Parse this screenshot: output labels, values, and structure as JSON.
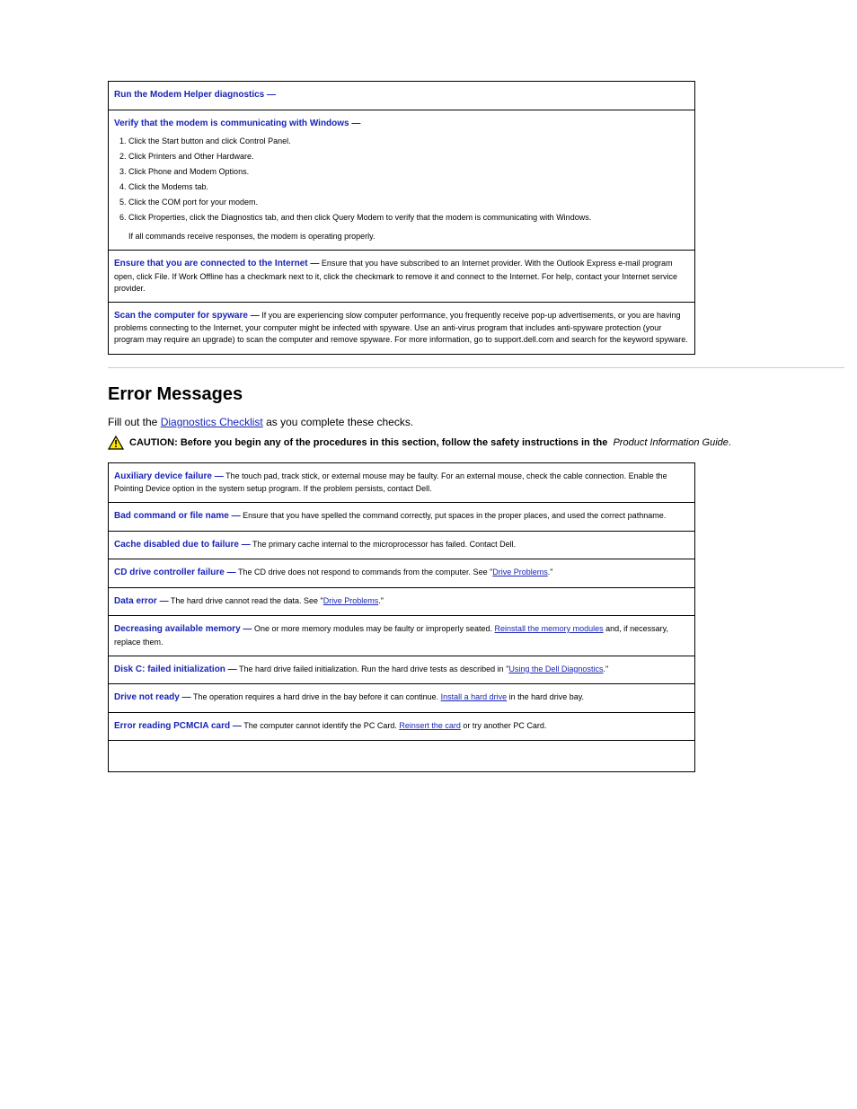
{
  "top_box": {
    "row1_heading": "Run the Modem Helper diagnostics —",
    "row2": {
      "heading": "Verify that the modem is communicating with Windows —",
      "l1": "Click the Start button and click Control Panel.",
      "l2": "Click Printers and Other Hardware.",
      "l3": "Click Phone and Modem Options.",
      "l4": "Click the Modems tab.",
      "l5": "Click the COM port for your modem.",
      "l6": "Click Properties, click the Diagnostics tab, and then click Query Modem to verify that the modem is communicating with Windows.",
      "l7": "If all commands receive responses, the modem is operating properly."
    },
    "row3_heading": "Ensure that you are connected to the Internet —",
    "row3_body": "Ensure that you have subscribed to an Internet provider. With the Outlook Express e-mail program open, click File. If Work Offline has a checkmark next to it, click the checkmark to remove it and connect to the Internet. For help, contact your Internet service provider.",
    "row4_heading": "Scan the computer for spyware —",
    "row4_body": "If you are experiencing slow computer performance, you frequently receive pop-up advertisements, or you are having problems connecting to the Internet, your computer might be infected with spyware. Use an anti-virus program that includes anti-spyware protection (your program may require an upgrade) to scan the computer and remove spyware. For more information, go to support.dell.com and search for the keyword spyware."
  },
  "section": {
    "title": "Error Messages",
    "crumb_label": "Fill out the",
    "crumb_link": "Diagnostics Checklist",
    "crumb_tail": "as you complete these checks.",
    "caution_strong": "CAUTION: Before you begin any of the procedures in this section, follow the safety instructions in the",
    "caution_em": "Product Information Guide",
    "caution_tail": "."
  },
  "tbl": {
    "r1_h": "Auxiliary device failure —",
    "r1_b": "The touch pad, track stick, or external mouse may be faulty. For an external mouse, check the cable connection. Enable the Pointing Device option in the system setup program. If the problem persists, contact Dell.",
    "r2_h": "Bad command or file name —",
    "r2_b": "Ensure that you have spelled the command correctly, put spaces in the proper places, and used the correct pathname.",
    "r3_h": "Cache disabled due to failure —",
    "r3_b": "The primary cache internal to the microprocessor has failed. Contact Dell.",
    "r4_h": "CD drive controller failure —",
    "r4_b": "The CD drive does not respond to commands from the computer. See \"",
    "r4_link": "Drive Problems",
    "r4_b2": ".\"",
    "r5_h": "Data error —",
    "r5_b": "The hard drive cannot read the data. See \"",
    "r5_link": "Drive Problems",
    "r5_b2": ".\"",
    "r6_h": "Decreasing available memory —",
    "r6_b": "One or more memory modules may be faulty or improperly seated. ",
    "r6_link": "Reinstall the memory modules",
    "r6_b2": " and, if necessary, replace them.",
    "r7_h": "Disk C: failed initialization —",
    "r7_b": "The hard drive failed initialization. Run the hard drive tests as described in \"",
    "r7_link": "Using the Dell Diagnostics",
    "r7_b2": ".\"",
    "r8_h": "Drive not ready —",
    "r8_b": "The operation requires a hard drive in the bay before it can continue. ",
    "r8_link": "Install a hard drive",
    "r8_b2": " in the hard drive bay.",
    "r9_h": "Error reading PCMCIA card —",
    "r9_b": "The computer cannot identify the PC Card. ",
    "r9_link": "Reinsert the card",
    "r9_b2": " or try another PC Card."
  }
}
